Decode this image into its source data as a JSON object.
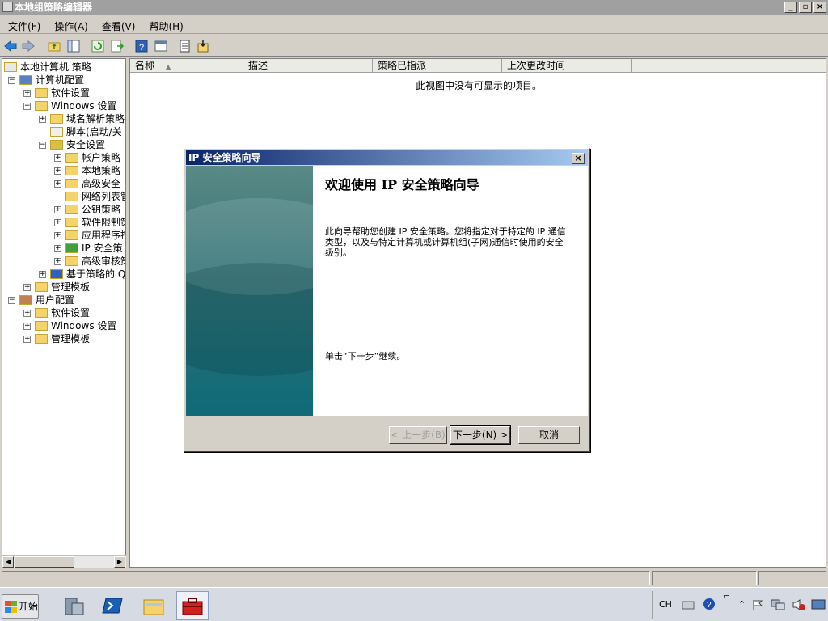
{
  "window": {
    "title": "本地组策略编辑器"
  },
  "menu": [
    "文件(F)",
    "操作(A)",
    "查看(V)",
    "帮助(H)"
  ],
  "tree": {
    "items": [
      {
        "label": "本地计算机 策略",
        "level": 0,
        "expander": "",
        "icon": "policy"
      },
      {
        "label": "计算机配置",
        "level": 1,
        "expander": "-",
        "icon": "computer"
      },
      {
        "label": "软件设置",
        "level": 2,
        "expander": "+",
        "icon": "folder"
      },
      {
        "label": "Windows 设置",
        "level": 2,
        "expander": "-",
        "icon": "folder"
      },
      {
        "label": "域名解析策略",
        "level": 3,
        "expander": "+",
        "icon": "folder"
      },
      {
        "label": "脚本(启动/关",
        "level": 3,
        "expander": "",
        "icon": "script"
      },
      {
        "label": "安全设置",
        "level": 3,
        "expander": "-",
        "icon": "security"
      },
      {
        "label": "帐户策略",
        "level": 4,
        "expander": "+",
        "icon": "folder"
      },
      {
        "label": "本地策略",
        "level": 4,
        "expander": "+",
        "icon": "folder"
      },
      {
        "label": "高级安全",
        "level": 4,
        "expander": "+",
        "icon": "folder"
      },
      {
        "label": "网络列表管",
        "level": 4,
        "expander": "",
        "icon": "folder"
      },
      {
        "label": "公钥策略",
        "level": 4,
        "expander": "+",
        "icon": "folder"
      },
      {
        "label": "软件限制策",
        "level": 4,
        "expander": "+",
        "icon": "folder"
      },
      {
        "label": "应用程序控",
        "level": 4,
        "expander": "+",
        "icon": "folder"
      },
      {
        "label": "IP 安全策",
        "level": 4,
        "expander": "+",
        "icon": "ipsec"
      },
      {
        "label": "高级审核策",
        "level": 4,
        "expander": "+",
        "icon": "folder"
      },
      {
        "label": "基于策略的 Q",
        "level": 3,
        "expander": "+",
        "icon": "chart"
      },
      {
        "label": "管理模板",
        "level": 2,
        "expander": "+",
        "icon": "folder"
      },
      {
        "label": "用户配置",
        "level": 1,
        "expander": "-",
        "icon": "user"
      },
      {
        "label": "软件设置",
        "level": 2,
        "expander": "+",
        "icon": "folder"
      },
      {
        "label": "Windows 设置",
        "level": 2,
        "expander": "+",
        "icon": "folder"
      },
      {
        "label": "管理模板",
        "level": 2,
        "expander": "+",
        "icon": "folder"
      }
    ]
  },
  "list": {
    "columns": [
      "名称",
      "描述",
      "策略已指派",
      "上次更改时间"
    ],
    "empty_message": "此视图中没有可显示的项目。"
  },
  "dialog": {
    "title": "IP 安全策略向导",
    "heading": "欢迎使用 IP 安全策略向导",
    "description": "此向导帮助您创建 IP 安全策略。您将指定对于特定的 IP 通信类型，以及与特定计算机或计算机组(子网)通信时使用的安全级别。",
    "instruction": "单击“下一步”继续。",
    "back_label": "< 上一步(B)",
    "next_label": "下一步(N) >",
    "cancel_label": "取消"
  },
  "taskbar": {
    "start_label": "开始",
    "language": "CH"
  }
}
